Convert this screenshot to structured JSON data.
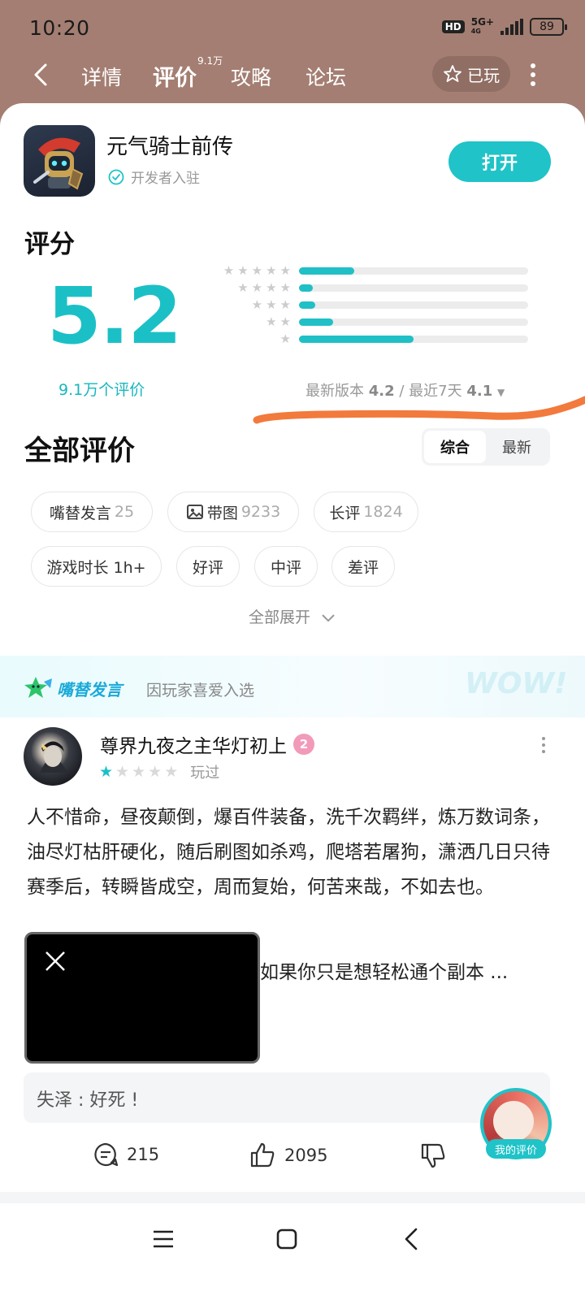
{
  "status": {
    "time": "10:20",
    "hd": "HD",
    "network": "5G+",
    "network_sub": "4G",
    "battery": "89"
  },
  "nav": {
    "tabs": [
      "详情",
      "评价",
      "攻略",
      "论坛"
    ],
    "active_tab_index": 1,
    "review_count_badge": "9.1万",
    "played_label": "已玩"
  },
  "app": {
    "name": "元气骑士前传",
    "developer_label": "开发者入驻",
    "open_button": "打开"
  },
  "rating": {
    "title": "评分",
    "score": "5.2",
    "count_label": "9.1万个评价",
    "distribution": [
      {
        "stars": 5,
        "fraction": 0.24
      },
      {
        "stars": 4,
        "fraction": 0.06
      },
      {
        "stars": 3,
        "fraction": 0.07
      },
      {
        "stars": 2,
        "fraction": 0.15
      },
      {
        "stars": 1,
        "fraction": 0.5
      }
    ],
    "latest_label": "最新版本",
    "latest_value": "4.2",
    "separator": "/",
    "recent_label": "最近7天",
    "recent_value": "4.1"
  },
  "reviews": {
    "title": "全部评价",
    "sort": [
      "综合",
      "最新"
    ],
    "filters": [
      {
        "label": "嘴替发言",
        "count": "25"
      },
      {
        "label": "带图",
        "count": "9233"
      },
      {
        "label": "长评",
        "count": "1824"
      },
      {
        "label": "游戏时长 1h+",
        "count": ""
      },
      {
        "label": "好评",
        "count": ""
      },
      {
        "label": "中评",
        "count": ""
      },
      {
        "label": "差评",
        "count": ""
      }
    ],
    "expand_label": "全部展开",
    "featured": {
      "tag": "嘴替发言",
      "reason": "因玩家喜爱入选",
      "deco": "WOW!"
    }
  },
  "review": {
    "username": "尊界九夜之主华灯初上",
    "level": "2",
    "stars": 1,
    "status": "玩过",
    "text": "人不惜命，昼夜颠倒，爆百件装备，洗千次羁绊，炼万数词条，油尽灯枯肝硬化，随后刷图如杀鸡，爬塔若屠狗，潇洒几日只待赛季后，转瞬皆成空，周而复始，何苦来哉，不如去也。",
    "text2": "如果你只是想轻松通个副本 ...",
    "top_comment": "失泽 : 好死 !",
    "comments": "215",
    "likes": "2095"
  },
  "my_review_label": "我的评价"
}
